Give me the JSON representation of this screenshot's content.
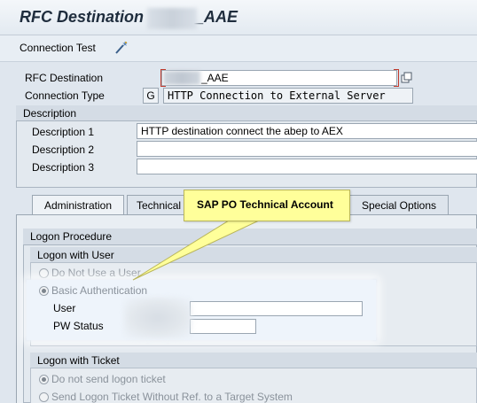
{
  "title": {
    "prefix": "RFC Destination",
    "suffix": "_AAE"
  },
  "toolbar": {
    "connection_test_label": "Connection Test",
    "connection_test_icon": "magic-wand-icon"
  },
  "fields": {
    "rfc_destination_label": "RFC Destination",
    "rfc_destination_value": "_AAE",
    "connection_type_label": "Connection Type",
    "connection_type_code": "G",
    "connection_type_desc": "HTTP Connection to External Server"
  },
  "description": {
    "header": "Description",
    "rows": [
      {
        "label": "Description 1",
        "value": "HTTP destination connect the abep to AEX"
      },
      {
        "label": "Description 2",
        "value": ""
      },
      {
        "label": "Description 3",
        "value": ""
      }
    ]
  },
  "tabs": [
    {
      "label": "Administration",
      "active": true
    },
    {
      "label": "Technical",
      "active": false
    },
    {
      "label": "Special Options",
      "active": false
    }
  ],
  "logon_procedure": {
    "header": "Logon Procedure",
    "logon_with_user": {
      "header": "Logon with User",
      "options": [
        {
          "label": "Do Not Use a User",
          "selected": false
        },
        {
          "label": "Basic Authentication",
          "selected": true
        }
      ],
      "user_label": "User",
      "user_value": "",
      "pw_status_label": "PW Status",
      "pw_status_value": ""
    },
    "logon_with_ticket": {
      "header": "Logon with Ticket",
      "options": [
        {
          "label": "Do not send logon ticket",
          "selected": true
        },
        {
          "label": "Send Logon Ticket Without Ref. to a Target System",
          "selected": false
        }
      ]
    }
  },
  "callout": {
    "text": "SAP PO Technical Account"
  },
  "colors": {
    "background": "#dfe6ee",
    "callout_fill": "#ffff9a",
    "highlight": "#eef4fb"
  }
}
